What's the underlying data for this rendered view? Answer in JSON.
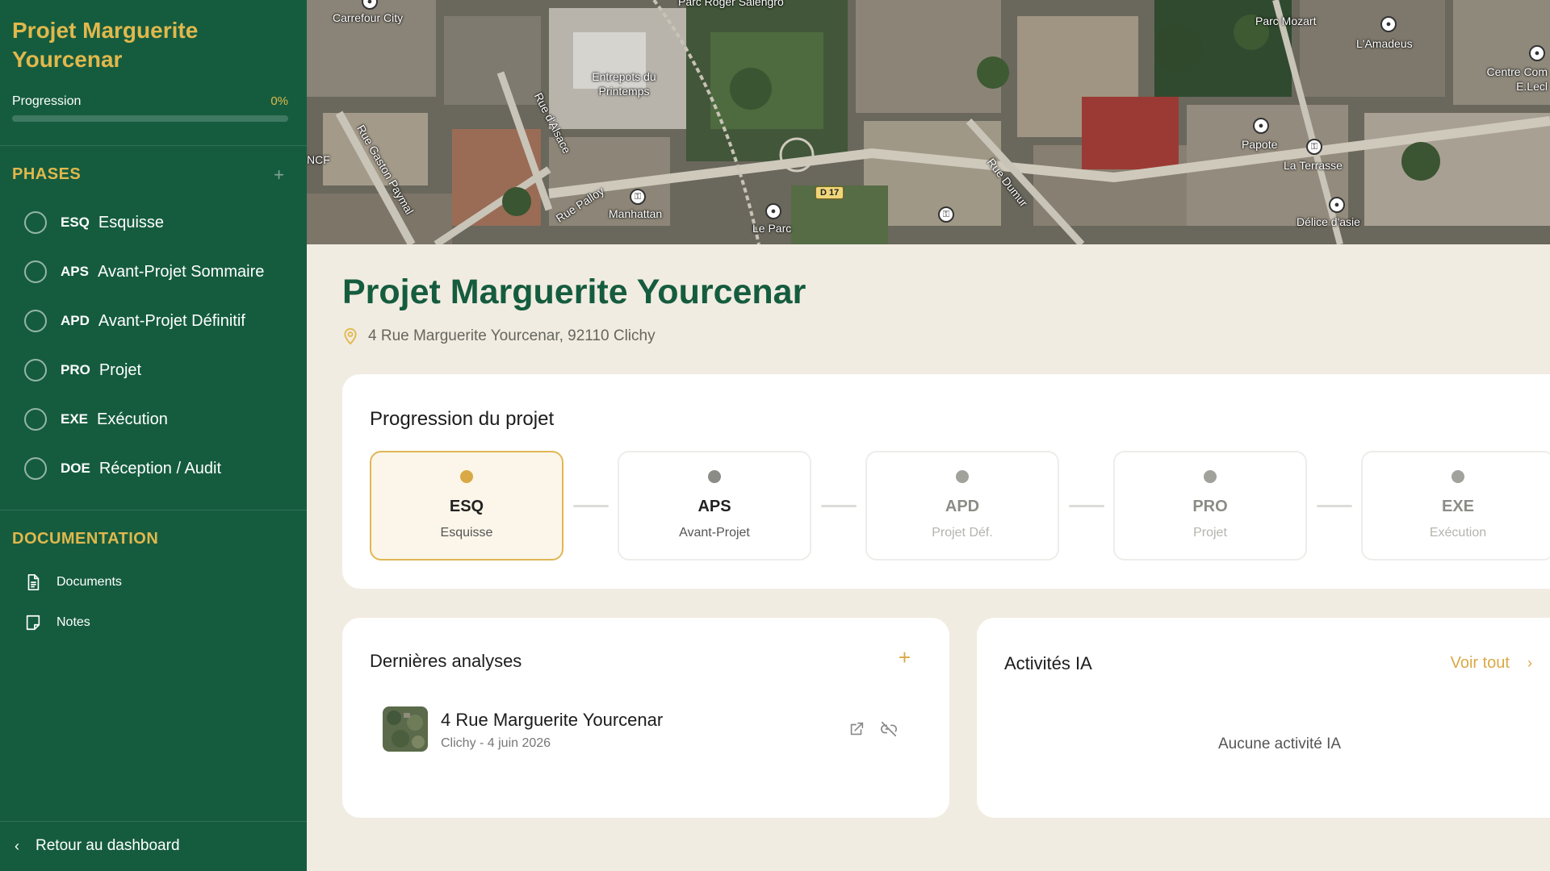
{
  "sidebar": {
    "project_title": "Projet Marguerite Yourcenar",
    "progress_label": "Progression",
    "progress_value": "0%",
    "progress_fraction": 0,
    "phases_heading": "PHASES",
    "add_icon": "plus-icon",
    "phases": [
      {
        "code": "ESQ",
        "name": "Esquisse"
      },
      {
        "code": "APS",
        "name": "Avant-Projet Sommaire"
      },
      {
        "code": "APD",
        "name": "Avant-Projet Définitif"
      },
      {
        "code": "PRO",
        "name": "Projet"
      },
      {
        "code": "EXE",
        "name": "Exécution"
      },
      {
        "code": "DOE",
        "name": "Réception / Audit"
      }
    ],
    "documentation_heading": "DOCUMENTATION",
    "doc_items": [
      {
        "label": "Documents",
        "icon": "document-icon"
      },
      {
        "label": "Notes",
        "icon": "note-icon"
      }
    ],
    "back_label": "Retour au dashboard"
  },
  "map": {
    "labels": [
      "Carrefour City",
      "Parc Roger Salengro",
      "Entrepots du Printemps",
      "Rue d'Alsace",
      "Rue Gaston Paymal",
      "NCF",
      "Rue Palloy",
      "Manhattan",
      "Le Parc",
      "D 17",
      "Rue Dumur",
      "Parc Mozart",
      "L'Amadeus",
      "Centre Com E.Lecl",
      "Papote",
      "La Terrasse",
      "Délice d'asie"
    ]
  },
  "main": {
    "title": "Projet Marguerite Yourcenar",
    "address": "4 Rue Marguerite Yourcenar, 92110 Clichy",
    "progress_card": {
      "title": "Progression du projet",
      "steps": [
        {
          "code": "ESQ",
          "sub": "Esquisse"
        },
        {
          "code": "APS",
          "sub": "Avant-Projet"
        },
        {
          "code": "APD",
          "sub": "Projet Déf."
        },
        {
          "code": "PRO",
          "sub": "Projet"
        },
        {
          "code": "EXE",
          "sub": "Exécution"
        }
      ],
      "active_step": "ESQ"
    },
    "analyses": {
      "title": "Dernières analyses",
      "items": [
        {
          "title": "4 Rue Marguerite Yourcenar",
          "meta": "Clichy - 4 juin 2026"
        }
      ]
    },
    "ia": {
      "title": "Activités IA",
      "link": "Voir tout",
      "empty": "Aucune activité IA"
    }
  },
  "colors": {
    "sidebar_bg": "#155c3f",
    "accent_gold": "#e1b84c",
    "page_bg": "#f1ece1",
    "title_green": "#155c3f"
  }
}
